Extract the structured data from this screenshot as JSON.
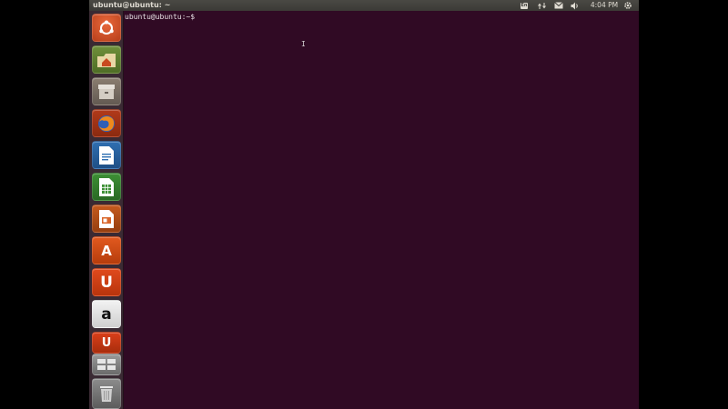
{
  "top_panel": {
    "window_title": "ubuntu@ubuntu: ~",
    "keyboard_layout": "En",
    "clock": "4:04 PM",
    "icons": [
      "keyboard-icon",
      "network-icon",
      "mail-icon",
      "sound-icon",
      "settings-gear-icon"
    ]
  },
  "launcher": {
    "items": [
      {
        "name": "dash-home",
        "icon": "ubuntu-logo-icon"
      },
      {
        "name": "files",
        "icon": "home-folder-icon"
      },
      {
        "name": "archive-manager",
        "icon": "archive-icon"
      },
      {
        "name": "firefox",
        "icon": "firefox-icon"
      },
      {
        "name": "libreoffice-writer",
        "icon": "writer-document-icon"
      },
      {
        "name": "libreoffice-calc",
        "icon": "calc-spreadsheet-icon"
      },
      {
        "name": "libreoffice-impress",
        "icon": "impress-presentation-icon"
      },
      {
        "name": "ubuntu-software-center",
        "icon": "software-center-icon",
        "glyph": "A"
      },
      {
        "name": "ubuntu-one",
        "icon": "ubuntu-one-icon",
        "glyph": "U"
      },
      {
        "name": "amazon",
        "icon": "amazon-icon",
        "glyph": "a"
      },
      {
        "name": "ubuntu-one-music",
        "icon": "ubuntu-one-music-icon",
        "glyph": "U"
      },
      {
        "name": "workspace-switcher",
        "icon": "workspaces-icon"
      },
      {
        "name": "trash",
        "icon": "trash-icon"
      }
    ]
  },
  "terminal": {
    "prompt": "ubuntu@ubuntu:~$",
    "background": "#300a24"
  },
  "colors": {
    "panel": "#3b3a36",
    "launcher": "#3a2a33",
    "accent_orange": "#e2591f"
  }
}
